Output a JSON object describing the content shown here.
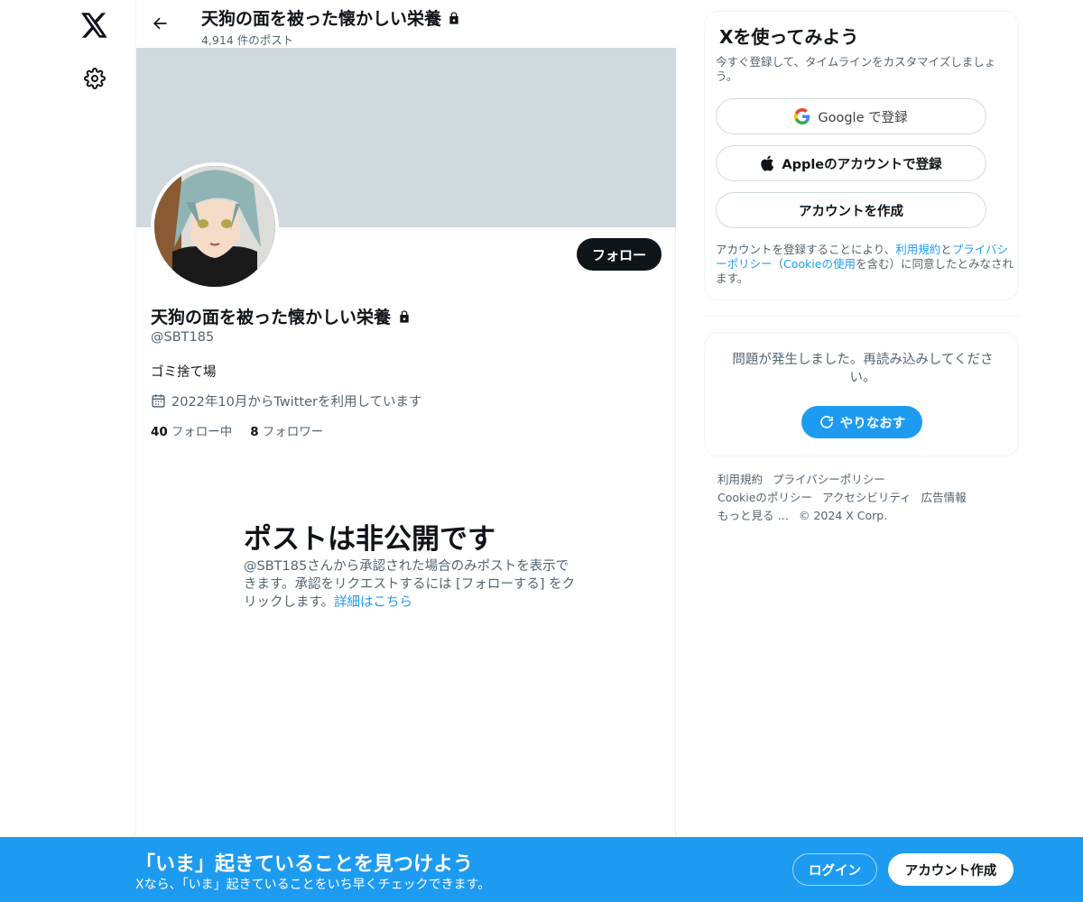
{
  "header": {
    "title": "天狗の面を被った懐かしい栄養",
    "post_count": "4,914 件のポスト"
  },
  "profile": {
    "display_name": "天狗の面を被った懐かしい栄養",
    "handle": "@SBT185",
    "bio": "ゴミ捨て場",
    "joined": "2022年10月からTwitterを利用しています",
    "following_count": "40",
    "following_label": "フォロー中",
    "followers_count": "8",
    "followers_label": "フォロワー",
    "follow_label": "フォロー"
  },
  "private": {
    "title": "ポストは非公開です",
    "description": "@SBT185さんから承認された場合のみポストを表示できます。承認をリクエストするには [フォローする] をクリックします。",
    "link": "詳細はこちら"
  },
  "signup": {
    "title": "Xを使ってみよう",
    "description": "今すぐ登録して、タイムラインをカスタマイズしましょう。",
    "google_label": "Google で登録",
    "apple_label": "Appleのアカウントで登録",
    "create_label": "アカウントを作成",
    "legal_1": "アカウントを登録することにより、",
    "legal_terms": "利用規約",
    "legal_2": "と",
    "legal_privacy": "プライバシーポリシー",
    "legal_3": "（",
    "legal_cookie": "Cookieの使用",
    "legal_4": "を含む）に同意したとみなされます。"
  },
  "error": {
    "message": "問題が発生しました。再読み込みしてください。",
    "retry_label": "やりなおす"
  },
  "footer": {
    "terms": "利用規約",
    "privacy": "プライバシーポリシー",
    "cookie": "Cookieのポリシー",
    "accessibility": "アクセシビリティ",
    "ads": "広告情報",
    "more": "もっと見る …",
    "copyright": "© 2024 X Corp."
  },
  "bottom_bar": {
    "title": "「いま」起きていることを見つけよう",
    "subtitle": "Xなら、「いま」起きていることをいち早くチェックできます。",
    "login_label": "ログイン",
    "signup_label": "アカウント作成"
  },
  "colors": {
    "accent": "#1d9bf0",
    "banner": "#cfd9de",
    "text": "#0f1419",
    "secondary": "#536471"
  },
  "icons": [
    "x-logo-icon",
    "gear-icon",
    "back-arrow-icon",
    "lock-icon",
    "calendar-icon",
    "google-icon",
    "apple-icon",
    "refresh-icon"
  ]
}
